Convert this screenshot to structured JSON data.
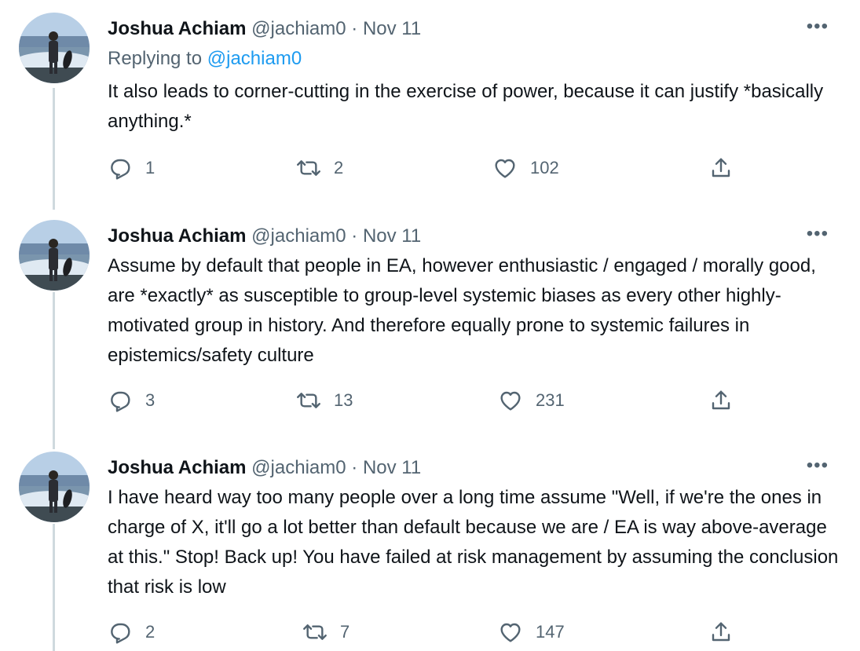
{
  "tweets": [
    {
      "author_name": "Joshua Achiam",
      "handle": "@jachiam0",
      "separator": "·",
      "date": "Nov 11",
      "replying_prefix": "Replying to",
      "replying_handle": "@jachiam0",
      "text": "It also leads to corner-cutting in the exercise of power, because it can justify *basically anything.*",
      "counts": {
        "replies": "1",
        "retweets": "2",
        "likes": "102"
      }
    },
    {
      "author_name": "Joshua Achiam",
      "handle": "@jachiam0",
      "separator": "·",
      "date": "Nov 11",
      "text": "Assume by default that people in EA, however enthusiastic / engaged / morally good, are *exactly* as susceptible to group-level systemic biases as every other highly-motivated group in history. And therefore equally prone to systemic failures in epistemics/safety culture",
      "counts": {
        "replies": "3",
        "retweets": "13",
        "likes": "231"
      }
    },
    {
      "author_name": "Joshua Achiam",
      "handle": "@jachiam0",
      "separator": "·",
      "date": "Nov 11",
      "text": "I have heard way too many people over a long time assume \"Well, if we're the ones in charge of X, it'll go a lot better than default because we are / EA is way above-average at this.\" Stop! Back up! You have failed at risk management by assuming the conclusion that risk is low",
      "counts": {
        "replies": "2",
        "retweets": "7",
        "likes": "147"
      }
    }
  ],
  "icons": {
    "reply": "reply-icon",
    "retweet": "retweet-icon",
    "like": "like-icon",
    "share": "share-icon",
    "more": "more-icon"
  },
  "colors": {
    "text": "#0f1419",
    "secondary": "#536471",
    "link": "#1d9bf0",
    "thread_line": "#cfd9de"
  }
}
